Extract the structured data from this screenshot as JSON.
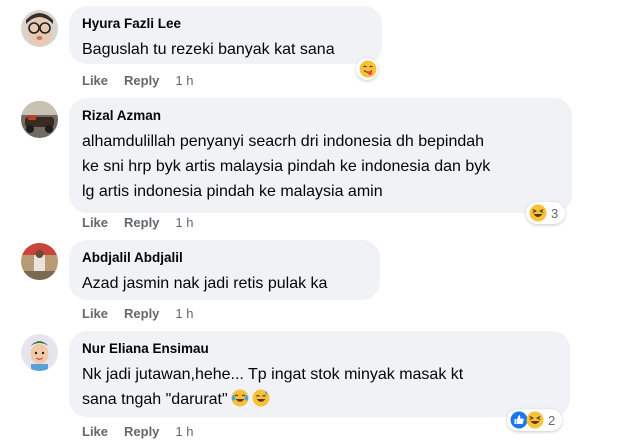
{
  "comments": [
    {
      "author": "Hyura Fazli Lee",
      "lines": [
        "Baguslah tu rezeki banyak kat sana"
      ],
      "actions": {
        "like": "Like",
        "reply": "Reply",
        "time": "1 h"
      },
      "reactions": {
        "icons": [
          "yum-emoji"
        ],
        "count": ""
      }
    },
    {
      "author": "Rizal Azman",
      "lines": [
        "alhamdulillah penyanyi seacrh dri indonesia dh bepindah",
        "ke sni hrp byk artis malaysia pindah ke indonesia dan byk",
        "lg artis indonesia pindah ke malaysia amin"
      ],
      "actions": {
        "like": "Like",
        "reply": "Reply",
        "time": "1 h"
      },
      "reactions": {
        "icons": [
          "haha-emoji"
        ],
        "count": "3"
      }
    },
    {
      "author": "Abdjalil Abdjalil",
      "lines": [
        "Azad jasmin nak jadi retis pulak ka"
      ],
      "actions": {
        "like": "Like",
        "reply": "Reply",
        "time": "1 h"
      },
      "reactions": null
    },
    {
      "author": "Nur Eliana Ensimau",
      "lines": [
        "Nk jadi jutawan,hehe... Tp ingat stok minyak masak kt",
        "sana tngah \"darurat\""
      ],
      "inline_emojis": [
        "tears-of-joy-emoji",
        "grinning-sweat-emoji"
      ],
      "actions": {
        "like": "Like",
        "reply": "Reply",
        "time": "1 h"
      },
      "reactions": {
        "icons": [
          "like-icon",
          "haha-emoji"
        ],
        "count": "2"
      }
    }
  ],
  "colors": {
    "bubble": "#f0f2f5",
    "secondary_text": "#65676b",
    "like_blue": "#1877f2",
    "emoji_yellow": "#f7c23a"
  }
}
